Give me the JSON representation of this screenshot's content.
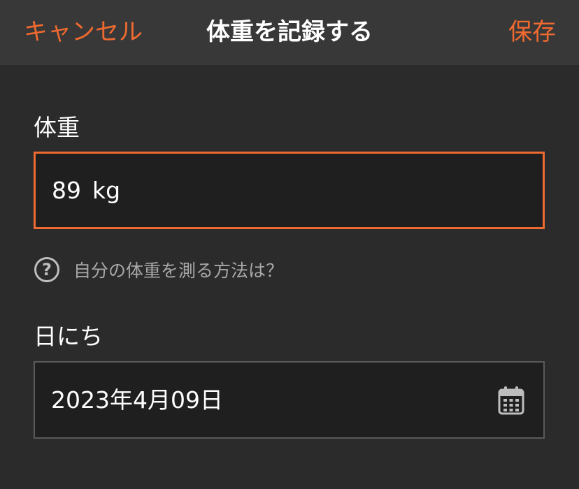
{
  "header": {
    "cancel_label": "キャンセル",
    "title": "体重を記録する",
    "save_label": "保存"
  },
  "weight": {
    "label": "体重",
    "value": "89",
    "unit": "kg"
  },
  "help": {
    "icon": "question-circle-icon",
    "text": "自分の体重を測る方法は？"
  },
  "date": {
    "label": "日にち",
    "value": "2023年4月09日",
    "icon": "calendar-icon"
  },
  "colors": {
    "accent": "#ef6a30",
    "background": "#2b2b2b",
    "header_background": "#383838",
    "field_background": "#1f1f1f"
  }
}
